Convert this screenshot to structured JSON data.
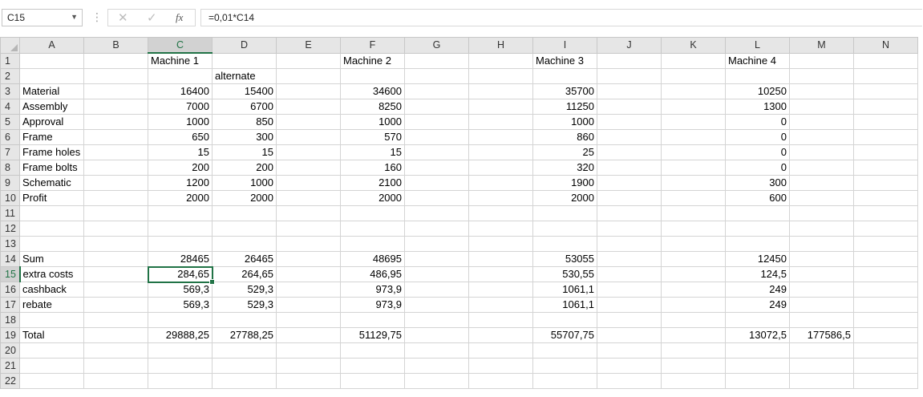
{
  "formula_bar": {
    "name_box": "C15",
    "cancel_icon": "✕",
    "enter_icon": "✓",
    "fx_label": "fx",
    "formula": "=0,01*C14"
  },
  "columns": [
    "A",
    "B",
    "C",
    "D",
    "E",
    "F",
    "G",
    "H",
    "I",
    "J",
    "K",
    "L",
    "M",
    "N"
  ],
  "selected_column": "C",
  "selected_row": 15,
  "rows": [
    {
      "n": "1",
      "A": "",
      "C": "Machine 1",
      "F": "Machine 2",
      "I": "Machine 3",
      "L": "Machine 4"
    },
    {
      "n": "2",
      "D": "alternate"
    },
    {
      "n": "3",
      "A": "Material",
      "C": "16400",
      "D": "15400",
      "F": "34600",
      "I": "35700",
      "L": "10250"
    },
    {
      "n": "4",
      "A": "Assembly",
      "C": "7000",
      "D": "6700",
      "F": "8250",
      "I": "11250",
      "L": "1300"
    },
    {
      "n": "5",
      "A": "Approval",
      "C": "1000",
      "D": "850",
      "F": "1000",
      "I": "1000",
      "L": "0"
    },
    {
      "n": "6",
      "A": "Frame",
      "C": "650",
      "D": "300",
      "F": "570",
      "I": "860",
      "L": "0"
    },
    {
      "n": "7",
      "A": "Frame holes",
      "C": "15",
      "D": "15",
      "F": "15",
      "I": "25",
      "L": "0"
    },
    {
      "n": "8",
      "A": "Frame bolts",
      "C": "200",
      "D": "200",
      "F": "160",
      "I": "320",
      "L": "0"
    },
    {
      "n": "9",
      "A": "Schematic",
      "C": "1200",
      "D": "1000",
      "F": "2100",
      "I": "1900",
      "L": "300"
    },
    {
      "n": "10",
      "A": "Profit",
      "C": "2000",
      "D": "2000",
      "F": "2000",
      "I": "2000",
      "L": "600"
    },
    {
      "n": "11"
    },
    {
      "n": "12"
    },
    {
      "n": "13"
    },
    {
      "n": "14",
      "A": "Sum",
      "C": "28465",
      "D": "26465",
      "F": "48695",
      "I": "53055",
      "L": "12450"
    },
    {
      "n": "15",
      "A": "extra costs",
      "C": "284,65",
      "D": "264,65",
      "F": "486,95",
      "I": "530,55",
      "L": "124,5"
    },
    {
      "n": "16",
      "A": "cashback",
      "C": "569,3",
      "D": "529,3",
      "F": "973,9",
      "I": "1061,1",
      "L": "249"
    },
    {
      "n": "17",
      "A": "rebate",
      "C": "569,3",
      "D": "529,3",
      "F": "973,9",
      "I": "1061,1",
      "L": "249"
    },
    {
      "n": "18"
    },
    {
      "n": "19",
      "A": "Total",
      "C": "29888,25",
      "D": "27788,25",
      "F": "51129,75",
      "I": "55707,75",
      "L": "13072,5",
      "M": "177586,5"
    },
    {
      "n": "20"
    },
    {
      "n": "21"
    },
    {
      "n": "22"
    }
  ],
  "colors": {
    "accent": "#217346",
    "header_bg": "#e6e6e6",
    "gridline": "#d4d4d4"
  }
}
